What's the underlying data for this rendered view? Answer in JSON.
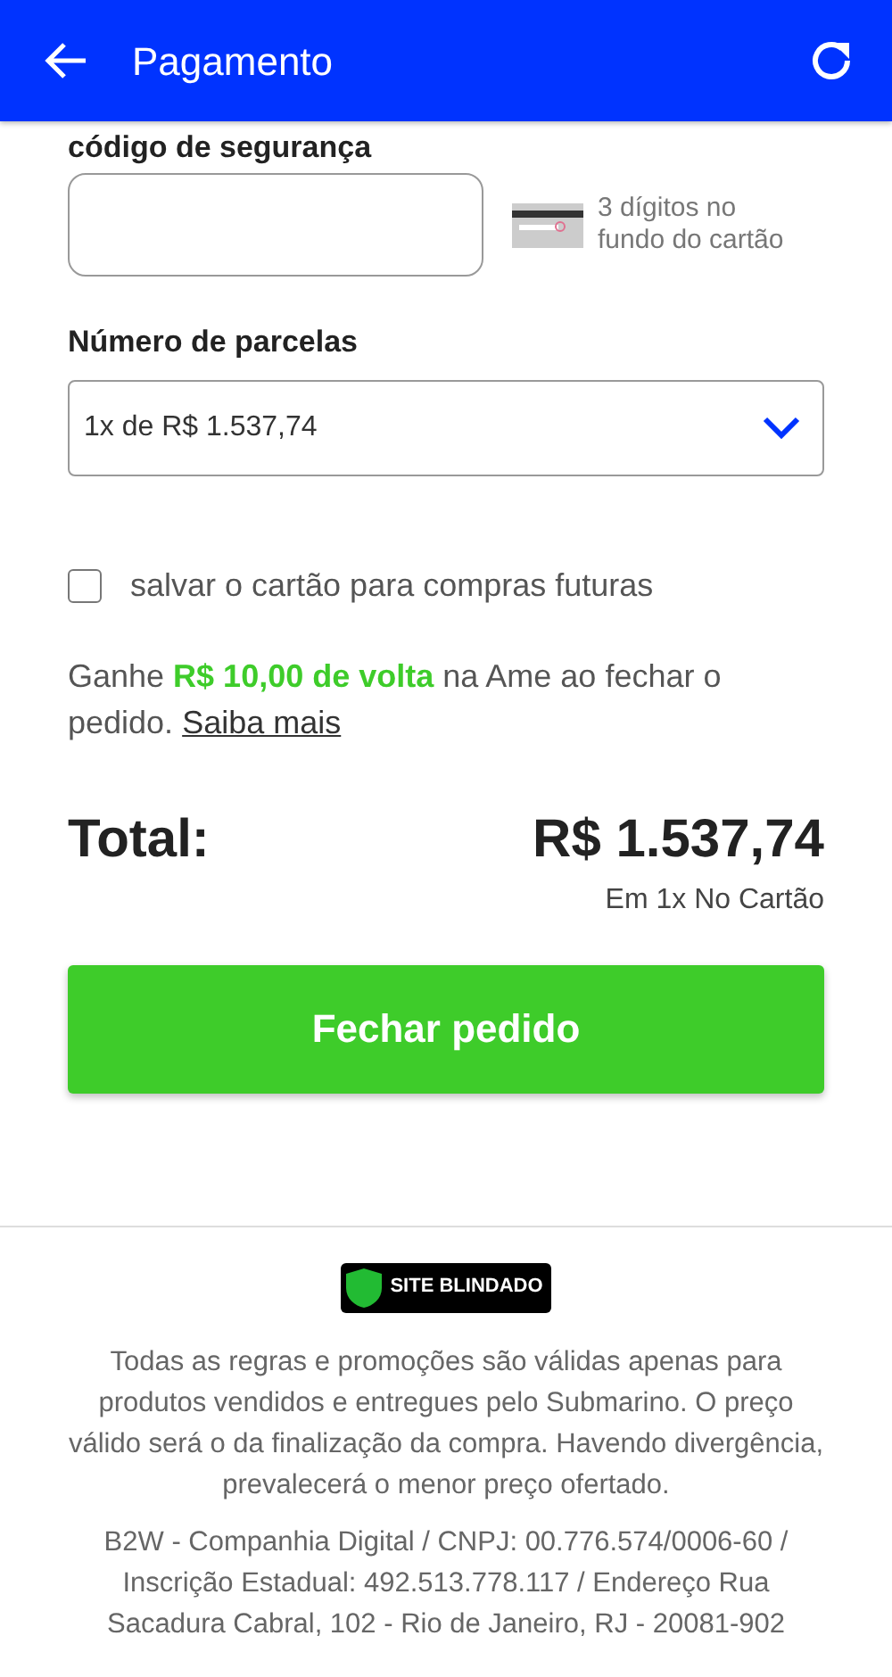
{
  "header": {
    "title": "Pagamento"
  },
  "security_code": {
    "label": "código de segurança",
    "hint": "3 dígitos no fundo do cartão"
  },
  "installments": {
    "label": "Número de parcelas",
    "value": "1x de R$ 1.537,74"
  },
  "save_card": {
    "label": "salvar o cartão para compras futuras",
    "checked": false
  },
  "cashback": {
    "text": "Ganhe **R$ 10,00 de volta** na Ame ao fechar o pedido.",
    "link": "Saiba mais"
  },
  "total": {
    "label": "Total:",
    "amount": "R$ 1.537,74",
    "detail": "Em 1x No Cartão"
  },
  "submit": "Fechar pedido",
  "footer": {
    "badge": "SITE BLINDADO",
    "notice": "Todas as regras e promoções são válidas apenas para produtos vendidos e entregues pelo Submarino. O preço válido será o da finalização da compra. Havendo divergência, prevalecerá o menor preço ofertado.",
    "company": "B2W - Companhia Digital / CNPJ: 00.776.574/0006-60 / Inscrição Estadual: 492.513.778.117 / Endereço Rua Sacadura Cabral, 102 - Rio de Janeiro, RJ - 20081-902"
  }
}
